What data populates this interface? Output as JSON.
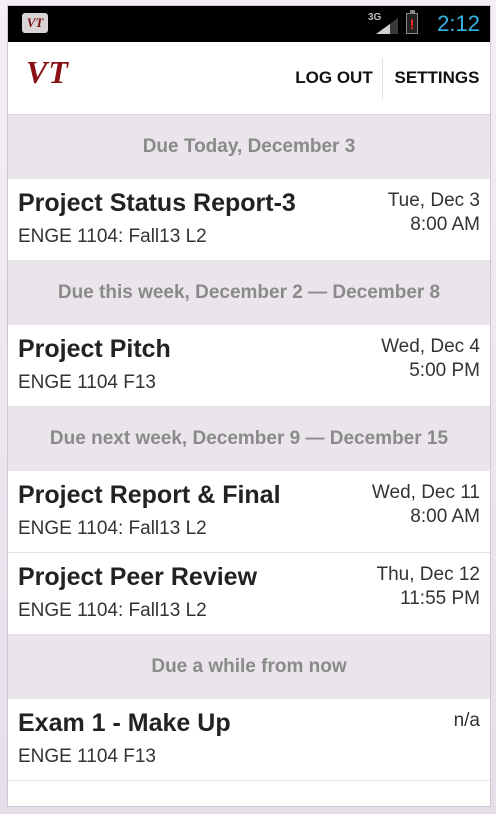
{
  "statusbar": {
    "app_icon_label": "VT",
    "network": "3G",
    "battery_warning": "!",
    "time": "2:12"
  },
  "actionbar": {
    "logo": "VT",
    "logout_label": "LOG OUT",
    "settings_label": "SETTINGS"
  },
  "sections": [
    {
      "header": "Due Today, December 3",
      "items": [
        {
          "title": "Project Status Report-3",
          "course": "ENGE 1104: Fall13 L2",
          "date": "Tue, Dec 3",
          "time": "8:00 AM"
        }
      ]
    },
    {
      "header": "Due this week, December 2 — December 8",
      "items": [
        {
          "title": "Project Pitch",
          "course": "ENGE 1104 F13",
          "date": "Wed, Dec 4",
          "time": "5:00 PM"
        }
      ]
    },
    {
      "header": "Due next week, December 9 — December 15",
      "items": [
        {
          "title": "Project Report & Final",
          "course": "ENGE 1104: Fall13 L2",
          "date": "Wed, Dec 11",
          "time": "8:00 AM"
        },
        {
          "title": "Project Peer Review",
          "course": "ENGE 1104: Fall13 L2",
          "date": "Thu, Dec 12",
          "time": "11:55 PM"
        }
      ]
    },
    {
      "header": "Due a while from now",
      "items": [
        {
          "title": "Exam 1 - Make Up",
          "course": "ENGE 1104 F13",
          "date": "n/a",
          "time": ""
        }
      ]
    }
  ]
}
